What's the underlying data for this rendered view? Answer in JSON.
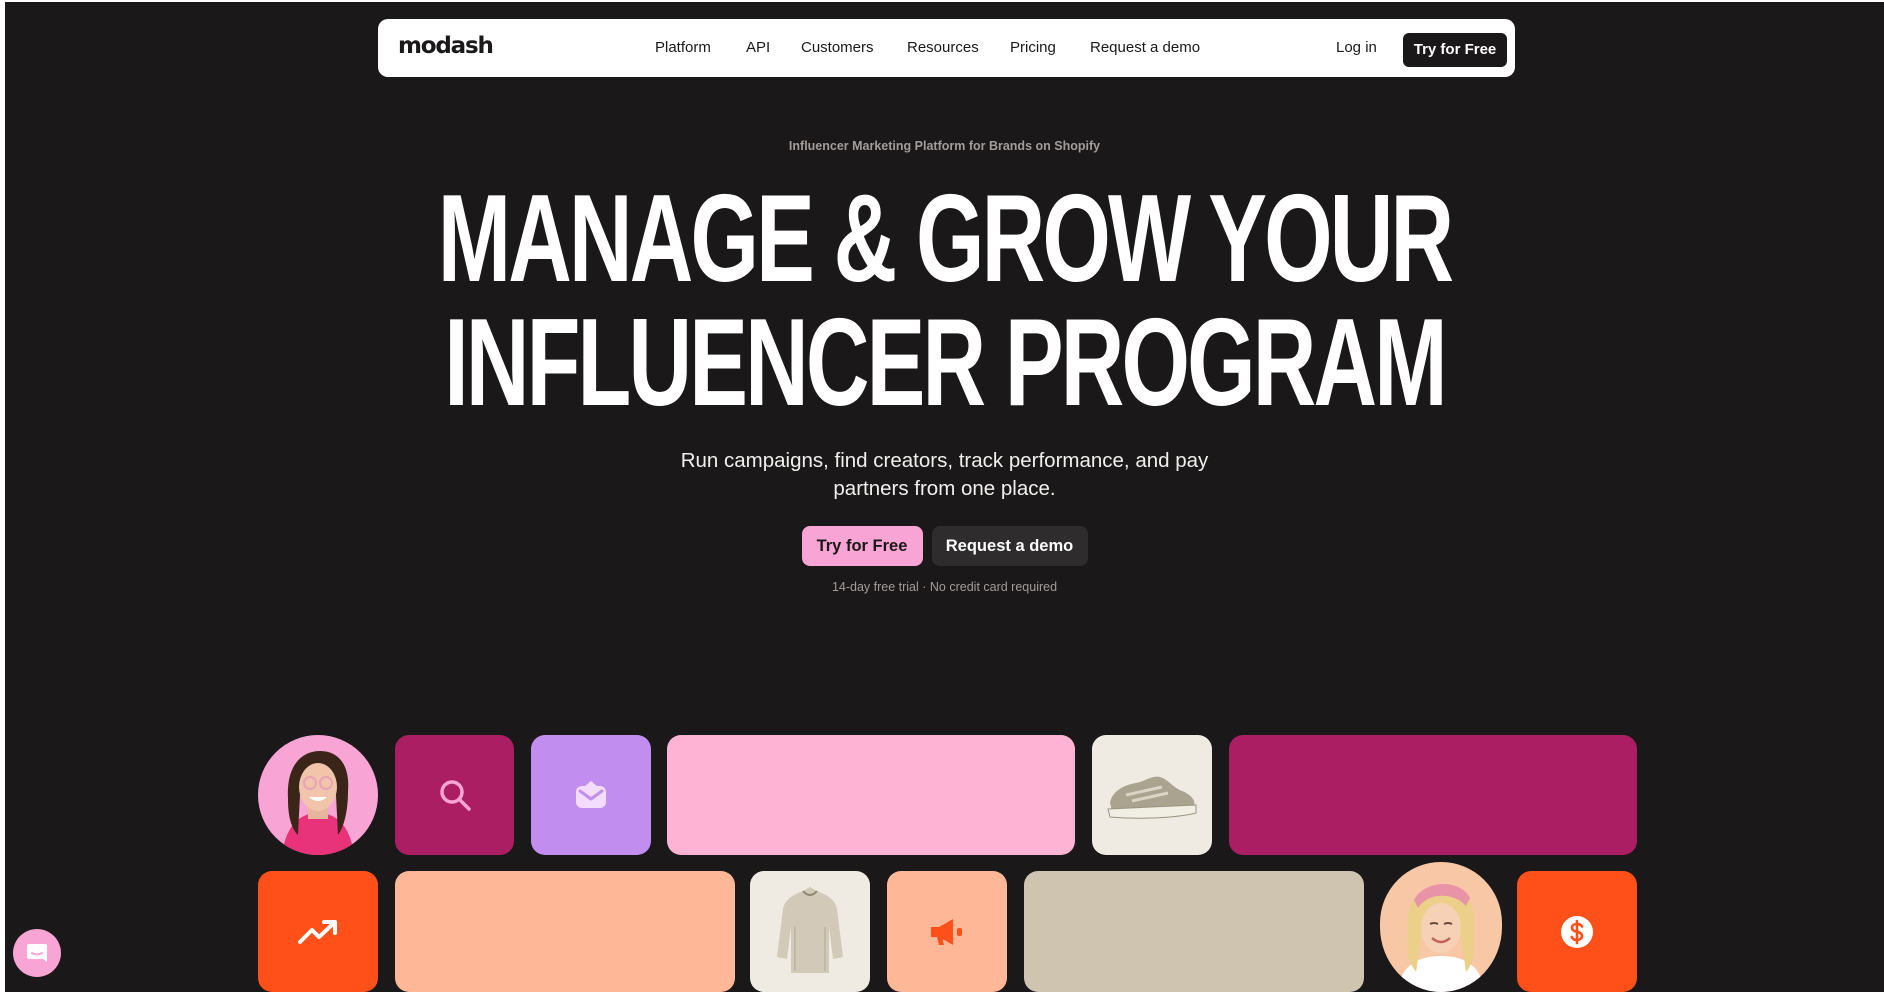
{
  "nav": {
    "logo": "modash",
    "links": [
      "Platform",
      "API",
      "Customers",
      "Resources",
      "Pricing",
      "Request a demo"
    ],
    "login": "Log in",
    "cta": "Try for Free"
  },
  "hero": {
    "eyebrow": "Influencer Marketing Platform for Brands on Shopify",
    "headline_line1": "MANAGE & GROW YOUR",
    "headline_line2": "INFLUENCER PROGRAM",
    "subhead_line1": "Run campaigns, find creators, track performance, and pay",
    "subhead_line2": "partners from one place.",
    "primary_cta": "Try for Free",
    "secondary_cta": "Request a demo",
    "note": "14-day free trial · No credit card required"
  },
  "colors": {
    "background": "#1a1818",
    "pink": "#f8a4d4",
    "magenta": "#ab1e63",
    "lavender": "#c18ef0",
    "orange": "#ff5019",
    "peach": "#feb897",
    "beige": "#cec4b0",
    "cream": "#efebe3"
  },
  "tiles": {
    "icons": [
      "search-icon",
      "mail-icon",
      "trend-up-icon",
      "megaphone-icon",
      "dollar-icon"
    ],
    "images": [
      "creator-avatar-pink",
      "sneaker-image",
      "sweater-image",
      "creator-avatar-headband"
    ]
  },
  "chat": {
    "icon": "chat-icon"
  }
}
